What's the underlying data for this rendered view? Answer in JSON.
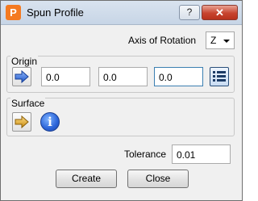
{
  "window": {
    "title": "Spun Profile",
    "help_glyph": "?",
    "close_glyph": "✕"
  },
  "axis": {
    "label": "Axis of Rotation",
    "value": "Z"
  },
  "origin": {
    "legend": "Origin",
    "x": "0.0",
    "y": "0.0",
    "z": "0.0"
  },
  "surface": {
    "legend": "Surface"
  },
  "tolerance": {
    "label": "Tolerance",
    "value": "0.01"
  },
  "buttons": {
    "create": "Create",
    "close": "Close"
  },
  "icons": {
    "app": "powermill-app-icon",
    "origin_pick": "blue-arrow-icon",
    "origin_list": "list-edit-icon",
    "surface_pick": "yellow-arrow-icon",
    "info": "info-icon"
  },
  "colors": {
    "app_icon": "#f47a21",
    "close_button": "#c7442f",
    "blue_arrow": "#2f6fd6",
    "yellow_arrow": "#d8a21e",
    "info": "#2a63d8"
  }
}
